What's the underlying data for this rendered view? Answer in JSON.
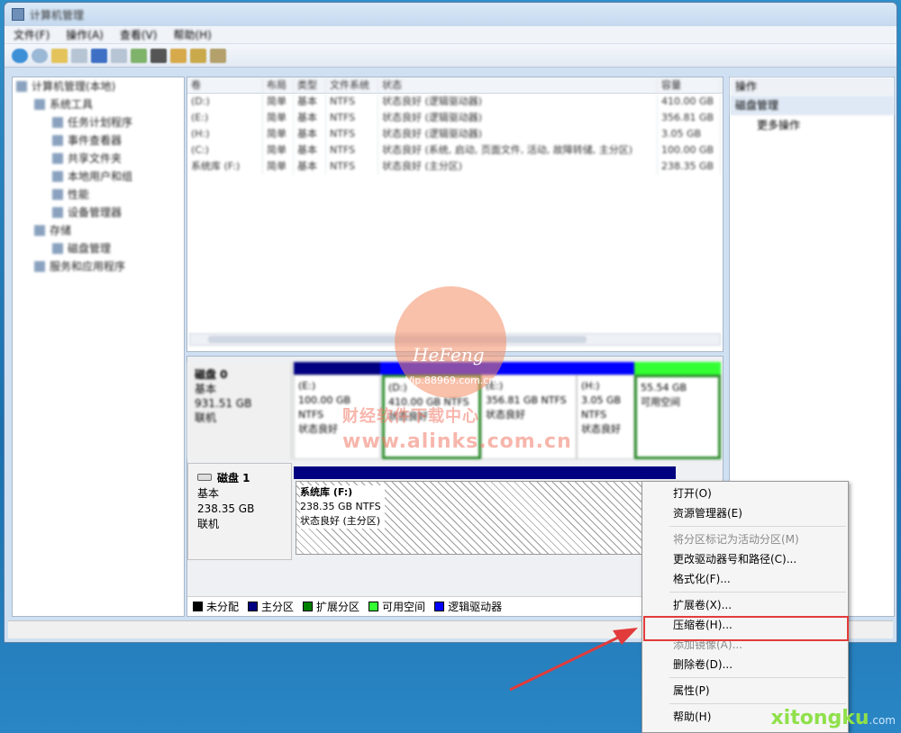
{
  "window": {
    "title": "计算机管理"
  },
  "menubar": [
    "文件(F)",
    "操作(A)",
    "查看(V)",
    "帮助(H)"
  ],
  "toolbar": {
    "icon_count": 11
  },
  "tree": {
    "items": [
      {
        "label": "计算机管理(本地)",
        "level": 0
      },
      {
        "label": "系统工具",
        "level": 1
      },
      {
        "label": "任务计划程序",
        "level": 2
      },
      {
        "label": "事件查看器",
        "level": 2
      },
      {
        "label": "共享文件夹",
        "level": 2
      },
      {
        "label": "本地用户和组",
        "level": 2
      },
      {
        "label": "性能",
        "level": 2
      },
      {
        "label": "设备管理器",
        "level": 2
      },
      {
        "label": "存储",
        "level": 1
      },
      {
        "label": "磁盘管理",
        "level": 2
      },
      {
        "label": "服务和应用程序",
        "level": 1
      }
    ]
  },
  "volume_list": {
    "columns": [
      "卷",
      "布局",
      "类型",
      "文件系统",
      "状态",
      "容量"
    ],
    "rows": [
      [
        "(D:)",
        "简单",
        "基本",
        "NTFS",
        "状态良好 (逻辑驱动器)",
        "410.00 GB"
      ],
      [
        "(E:)",
        "简单",
        "基本",
        "NTFS",
        "状态良好 (逻辑驱动器)",
        "356.81 GB"
      ],
      [
        "(H:)",
        "简单",
        "基本",
        "NTFS",
        "状态良好 (逻辑驱动器)",
        "3.05 GB"
      ],
      [
        "(C:)",
        "简单",
        "基本",
        "NTFS",
        "状态良好 (系统, 启动, 页面文件, 活动, 故障转储, 主分区)",
        "100.00 GB"
      ],
      [
        "系统库 (F:)",
        "简单",
        "基本",
        "NTFS",
        "状态良好 (主分区)",
        "238.35 GB"
      ]
    ]
  },
  "disk0": {
    "title": "磁盘 0",
    "type": "基本",
    "size": "931.51 GB",
    "status": "联机",
    "partitions": [
      {
        "name": "(E:)",
        "size": "100.00 GB NTFS",
        "status": "状态良好"
      },
      {
        "name": "(D:)",
        "size": "410.00 GB NTFS",
        "status": "状态良好"
      },
      {
        "name": "(E:)",
        "size": "356.81 GB NTFS",
        "status": "状态良好"
      },
      {
        "name": "(H:)",
        "size": "3.05 GB NTFS",
        "status": "状态良好"
      },
      {
        "name": "",
        "size": "55.54 GB",
        "status": "可用空间"
      }
    ]
  },
  "disk1": {
    "title": "磁盘 1",
    "type": "基本",
    "size": "238.35 GB",
    "status": "联机",
    "partition": {
      "name": "系统库  (F:)",
      "size": "238.35 GB NTFS",
      "status": "状态良好 (主分区)"
    }
  },
  "legend": [
    {
      "label": "未分配",
      "color": "#000000"
    },
    {
      "label": "主分区",
      "color": "#000080"
    },
    {
      "label": "扩展分区",
      "color": "#008000"
    },
    {
      "label": "可用空间",
      "color": "#33ff33"
    },
    {
      "label": "逻辑驱动器",
      "color": "#0000ff"
    }
  ],
  "actions": {
    "header": "操作",
    "section": "磁盘管理",
    "more": "更多操作"
  },
  "context_menu": {
    "items": [
      {
        "label": "打开(O)",
        "disabled": false
      },
      {
        "label": "资源管理器(E)",
        "disabled": false
      },
      {
        "sep": true
      },
      {
        "label": "将分区标记为活动分区(M)",
        "disabled": true
      },
      {
        "label": "更改驱动器号和路径(C)...",
        "disabled": false
      },
      {
        "label": "格式化(F)...",
        "disabled": false
      },
      {
        "sep": true
      },
      {
        "label": "扩展卷(X)...",
        "disabled": false
      },
      {
        "label": "压缩卷(H)...",
        "disabled": false
      },
      {
        "label": "添加镜像(A)...",
        "disabled": true
      },
      {
        "label": "删除卷(D)...",
        "disabled": false
      },
      {
        "sep": true
      },
      {
        "label": "属性(P)",
        "disabled": false
      },
      {
        "sep": true
      },
      {
        "label": "帮助(H)",
        "disabled": false
      }
    ]
  },
  "watermarks": {
    "logo_text": "HeFeng",
    "logo_sub": "Vip.88969.com.cn",
    "line1": "财经软件下载中心",
    "line2": "www.alinks.com.cn",
    "corner": "xitongku",
    "corner_sub": ".com"
  },
  "colors": {
    "primary": "#000080",
    "logical": "#0000ff",
    "free": "#33ff33",
    "extended": "#008000",
    "highlight": "#e23b3b"
  }
}
